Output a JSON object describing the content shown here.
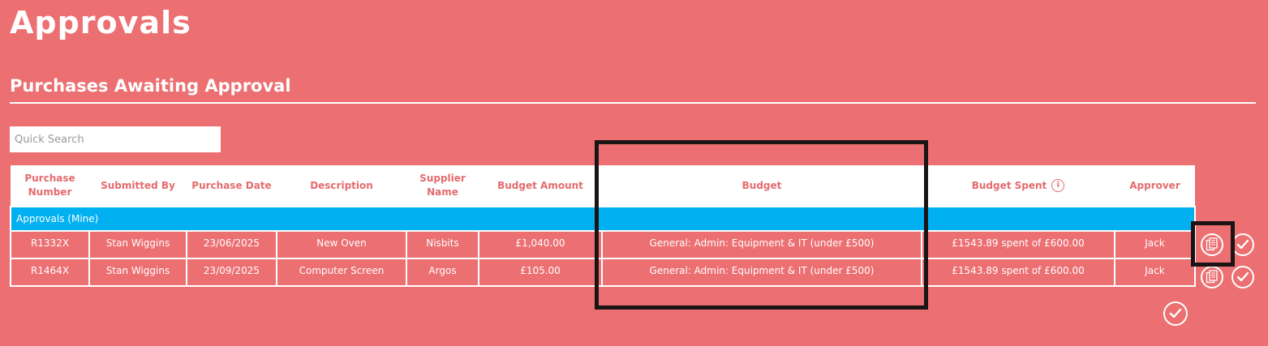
{
  "page": {
    "title": "Approvals"
  },
  "section": {
    "title": "Purchases Awaiting Approval"
  },
  "search": {
    "placeholder": "Quick Search"
  },
  "table": {
    "headers": {
      "purchase_number": "Purchase Number",
      "submitted_by": "Submitted By",
      "purchase_date": "Purchase Date",
      "description": "Description",
      "supplier_name": "Supplier Name",
      "budget_amount": "Budget Amount",
      "budget": "Budget",
      "budget_spent": "Budget Spent",
      "approver": "Approver"
    },
    "group_label": "Approvals (Mine)",
    "rows": [
      {
        "purchase_number": "R1332X",
        "submitted_by": "Stan Wiggins",
        "purchase_date": "23/06/2025",
        "description": "New Oven",
        "supplier_name": "Nisbits",
        "budget_amount": "£1,040.00",
        "budget": "General: Admin: Equipment & IT (under £500)",
        "budget_spent": "£1543.89 spent of £600.00",
        "approver": "Jack"
      },
      {
        "purchase_number": "R1464X",
        "submitted_by": "Stan Wiggins",
        "purchase_date": "23/09/2025",
        "description": "Computer Screen",
        "supplier_name": "Argos",
        "budget_amount": "£105.00",
        "budget": "General: Admin: Equipment & IT (under £500)",
        "budget_spent": "£1543.89 spent of £600.00",
        "approver": "Jack"
      }
    ]
  },
  "icons": {
    "info": "info-icon",
    "details": "document-icon",
    "approve": "checkmark-icon"
  },
  "colors": {
    "background": "#ec6f72",
    "header_text": "#e46b6e",
    "group_row": "#00b0f0",
    "highlight": "#1a1414"
  }
}
